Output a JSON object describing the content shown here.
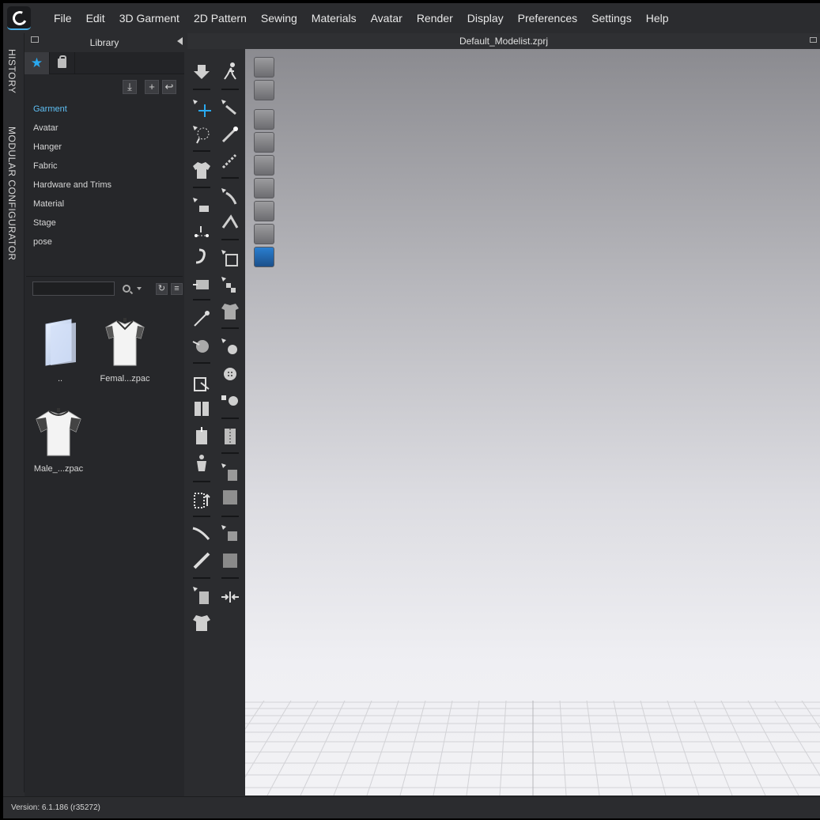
{
  "menu": [
    "File",
    "Edit",
    "3D Garment",
    "2D Pattern",
    "Sewing",
    "Materials",
    "Avatar",
    "Render",
    "Display",
    "Preferences",
    "Settings",
    "Help"
  ],
  "side_tabs": {
    "history": "HISTORY",
    "modular": "MODULAR CONFIGURATOR"
  },
  "library": {
    "title": "Library",
    "tree": [
      "Garment",
      "Avatar",
      "Hanger",
      "Fabric",
      "Hardware and Trims",
      "Material",
      "Stage",
      "pose"
    ],
    "active_tree_item": "Garment",
    "search": {
      "value": ""
    },
    "items": [
      {
        "label": ".."
      },
      {
        "label": "Femal...zpac"
      },
      {
        "label": "Male_...zpac"
      }
    ]
  },
  "viewport": {
    "title": "Default_Modelist.zprj"
  },
  "status": {
    "version": "Version: 6.1.186 (r35272)"
  },
  "colors": {
    "accent": "#29a9f0",
    "active_text": "#5fc0f5",
    "panel": "#26272a",
    "chrome": "#2b2c2f"
  }
}
